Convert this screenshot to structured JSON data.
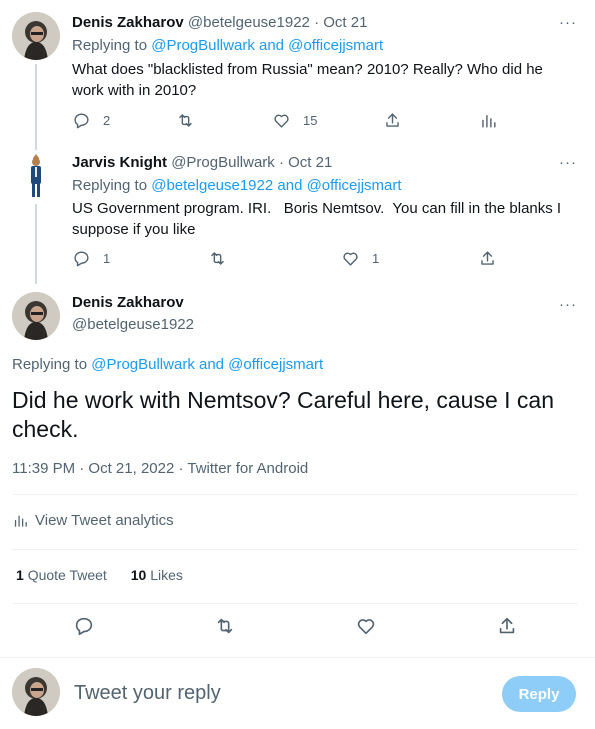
{
  "reply1": {
    "name": "Denis Zakharov",
    "handle": "@betelgeuse1922",
    "separator": "·",
    "date": "Oct 21",
    "replying_prefix": "Replying to",
    "replying_to": "@ProgBullwark and @officejjsmart",
    "text": "What does \"blacklisted from Russia\" mean? 2010? Really? Who did he work with in 2010?",
    "more": "···",
    "replies": "2",
    "retweets": "",
    "likes": "15"
  },
  "reply2": {
    "name": "Jarvis Knight",
    "handle": "@ProgBullwark",
    "separator": "·",
    "date": "Oct 21",
    "replying_prefix": "Replying to",
    "replying_to": "@betelgeuse1922 and @officejjsmart",
    "text": "US Government program. IRI.   Boris Nemtsov.  You can fill in the blanks I suppose if you like",
    "more": "···",
    "replies": "1",
    "retweets": "",
    "likes": "1"
  },
  "main": {
    "name": "Denis Zakharov",
    "handle": "@betelgeuse1922",
    "more": "···",
    "replying_prefix": "Replying to",
    "replying_to": "@ProgBullwark and @officejjsmart",
    "text": "Did he work with Nemtsov? Careful here, cause I can check.",
    "meta": "11:39 PM · Oct 21, 2022 · Twitter for Android",
    "analytics": "View Tweet analytics",
    "quote_count": "1",
    "quote_label": "Quote Tweet",
    "likes_count": "10",
    "likes_label": "Likes"
  },
  "composer": {
    "placeholder": "Tweet your reply",
    "reply_button": "Reply"
  },
  "colors": {
    "accent": "#1d9bf0",
    "reply_button_disabled": "#8ecdf7",
    "secondary_text": "#536471"
  },
  "icons": [
    "reply-icon",
    "retweet-icon",
    "like-icon",
    "share-icon",
    "analytics-icon",
    "more-icon"
  ]
}
